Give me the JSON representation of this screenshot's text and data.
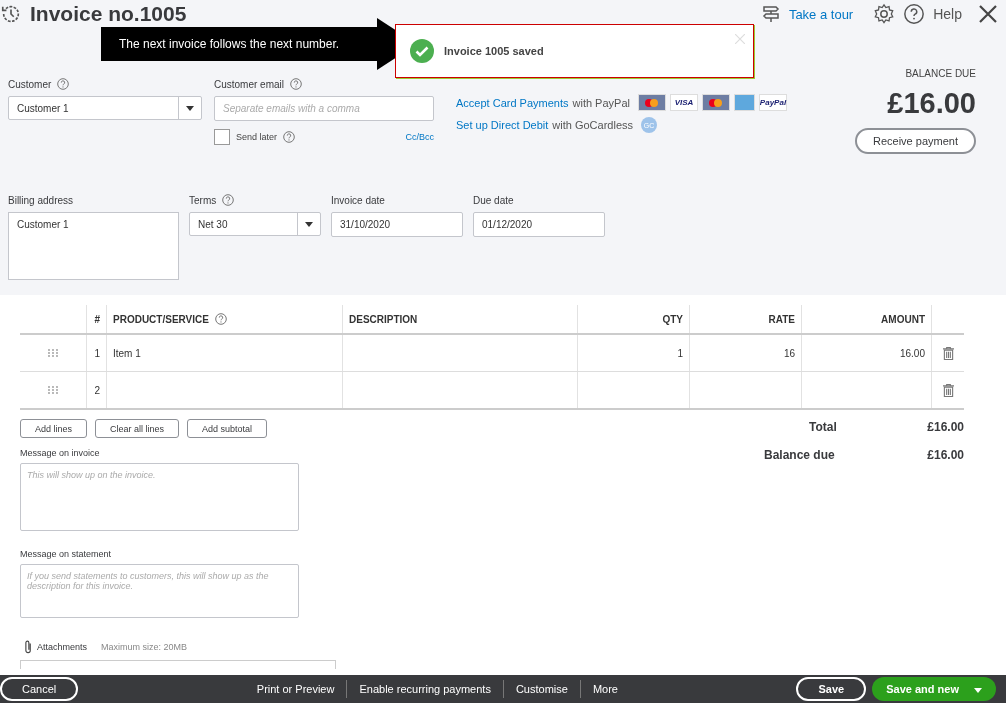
{
  "header": {
    "title": "Invoice no.1005",
    "tour": "Take a tour",
    "help": "Help"
  },
  "callout": {
    "text": "The next invoice follows the next number."
  },
  "toast": {
    "message": "Invoice 1005 saved"
  },
  "customer": {
    "label": "Customer",
    "value": "Customer 1"
  },
  "email": {
    "label": "Customer email",
    "placeholder": "Separate emails with a comma",
    "cc": "Cc/Bcc"
  },
  "send_later": {
    "label": "Send later",
    "checked": false
  },
  "payments": [
    {
      "link": "Accept Card Payments",
      "rest": "with PayPal",
      "kind": "cards"
    },
    {
      "link": "Set up Direct Debit",
      "rest": "with GoCardless",
      "kind": "badge",
      "badge": "GC"
    }
  ],
  "cards": [
    {
      "kind": "circles"
    },
    {
      "kind": "text",
      "text": "VISA"
    },
    {
      "kind": "circles"
    },
    {
      "kind": "amex"
    },
    {
      "kind": "text",
      "text": "PayPal"
    }
  ],
  "balance": {
    "label": "BALANCE DUE",
    "amount": "£16.00",
    "button": "Receive payment"
  },
  "billing": {
    "label": "Billing address",
    "value": "Customer 1"
  },
  "terms": {
    "label": "Terms",
    "value": "Net 30"
  },
  "dates": [
    {
      "label": "Invoice date",
      "value": "31/10/2020"
    },
    {
      "label": "Due date",
      "value": "01/12/2020"
    }
  ],
  "table": {
    "columns": [
      "#",
      "PRODUCT/SERVICE",
      "DESCRIPTION",
      "QTY",
      "RATE",
      "AMOUNT"
    ],
    "rows": [
      {
        "num": "1",
        "product": "Item 1",
        "qty": "1",
        "rate": "16",
        "amount": "16.00"
      },
      {
        "num": "2"
      }
    ]
  },
  "line_buttons": [
    "Add lines",
    "Clear all lines",
    "Add subtotal"
  ],
  "totals": [
    {
      "label": "Total",
      "value": "£16.00"
    },
    {
      "label": "Balance due",
      "value": "£16.00"
    }
  ],
  "messages": [
    {
      "label": "Message on invoice",
      "placeholder": "This will show up on the invoice.",
      "kind": "tall"
    },
    {
      "label": "Message on statement",
      "placeholder": "If you send statements to customers, this will show up as the description for this invoice.",
      "kind": "short"
    }
  ],
  "attachments": {
    "label": "Attachments",
    "note": "Maximum size: 20MB"
  },
  "footer": {
    "cancel": "Cancel",
    "actions": [
      "Print or Preview",
      "Enable recurring payments",
      "Customise",
      "More"
    ],
    "save": "Save",
    "save_new": "Save and new"
  }
}
